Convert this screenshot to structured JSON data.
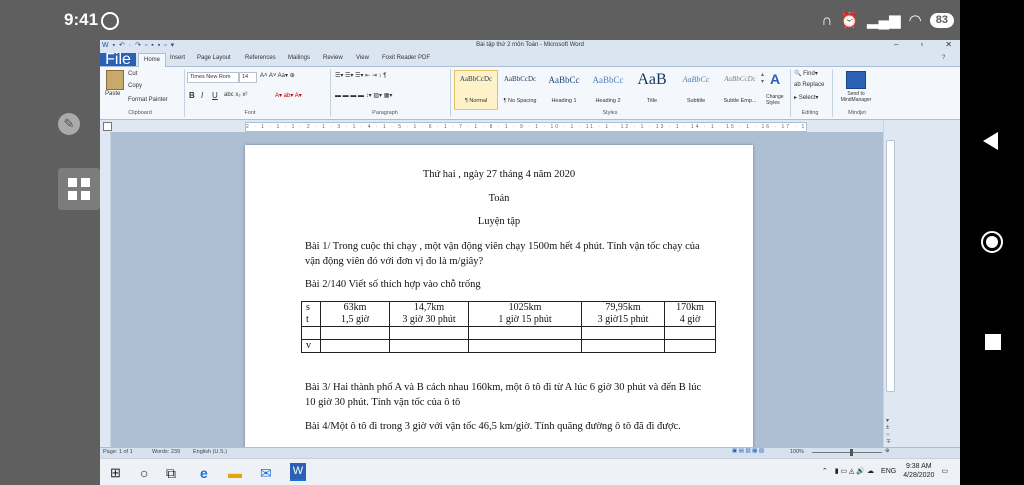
{
  "phone": {
    "time": "9:41",
    "battery": "83",
    "status_icons": [
      "headphones-icon",
      "alarm-icon",
      "signal-icon",
      "wifi-icon"
    ]
  },
  "word": {
    "title": "Bài tập thứ 2 môn Toán - Microsoft Word",
    "tabs": [
      "File",
      "Home",
      "Insert",
      "Page Layout",
      "References",
      "Mailings",
      "Review",
      "View",
      "Foxit Reader PDF"
    ],
    "clipboard": {
      "paste": "Paste",
      "cut": "Cut",
      "copy": "Copy",
      "format_painter": "Format Painter",
      "label": "Clipboard"
    },
    "font": {
      "name": "Times New Rom",
      "size": "14",
      "label": "Font"
    },
    "paragraph_label": "Paragraph",
    "styles": [
      {
        "preview": "AaBbCcDc",
        "name": "¶ Normal"
      },
      {
        "preview": "AaBbCcDc",
        "name": "¶ No Spacing"
      },
      {
        "preview": "AaBbCc",
        "name": "Heading 1"
      },
      {
        "preview": "AaBbCc",
        "name": "Heading 2"
      },
      {
        "preview": "AaB",
        "name": "Title"
      },
      {
        "preview": "AaBbCc",
        "name": "Subtitle"
      },
      {
        "preview": "AaBbCcDc",
        "name": "Subtle Emp..."
      }
    ],
    "styles_label": "Styles",
    "change_styles": "Change Styles",
    "editing": {
      "find": "Find",
      "replace": "Replace",
      "select": "Select",
      "label": "Editing"
    },
    "mindjet": {
      "send": "Send to MindManager",
      "label": "Mindjet"
    },
    "ruler_text": "2 · 1 · 1 · 1 · 2 · 1 · 3 · 1 · 4 · 1 · 5 · 1 · 6 · 1 · 7 · 1 · 8 · 1 · 9 · 1 · 10 · 1 · 11 · 1 · 12 · 1 · 13 · 1 · 14 · 1 · 15 · 1 · 16 · 17 · 18 · 19",
    "statusbar": {
      "page": "Page: 1 of 1",
      "words": "Words: 239",
      "language": "English (U.S.)",
      "zoom": "100%"
    }
  },
  "document": {
    "date_line": "Thứ hai , ngày 27 tháng 4 năm 2020",
    "subject": "Toán",
    "lesson": "Luyện tập",
    "bai1": "Bài 1/  Trong cuộc thi chạy , một vận động viên chạy 1500m hết 4 phút. Tính vận tốc chạy của vận động viên đó với đơn vị đo là m/giây?",
    "bai2": "Bài 2/140 Viết số thích hợp vào chỗ trống",
    "table": {
      "labels": [
        "s",
        "t",
        "v"
      ],
      "s": [
        "63km",
        "14,7km",
        "1025km",
        "79,95km",
        "170km"
      ],
      "t": [
        "1,5 giờ",
        "3 giờ 30 phút",
        "1 giờ 15 phút",
        "3 giờ15 phút",
        "4 giờ"
      ]
    },
    "bai3": "Bài 3/ Hai thành phố A và B cách nhau 160km, một ô tô đi từ A lúc 6 giờ 30 phút và đến B lúc 10 giờ 30 phút. Tính vận tốc của ô tô",
    "bai4": "Bài 4/Một ô tô đi trong 3 giờ với vận tốc 46,5 km/giờ. Tính quãng đường ô tô đã đi được."
  },
  "taskbar": {
    "lang": "ENG",
    "clock_time": "9:38 AM",
    "clock_date": "4/28/2020"
  }
}
